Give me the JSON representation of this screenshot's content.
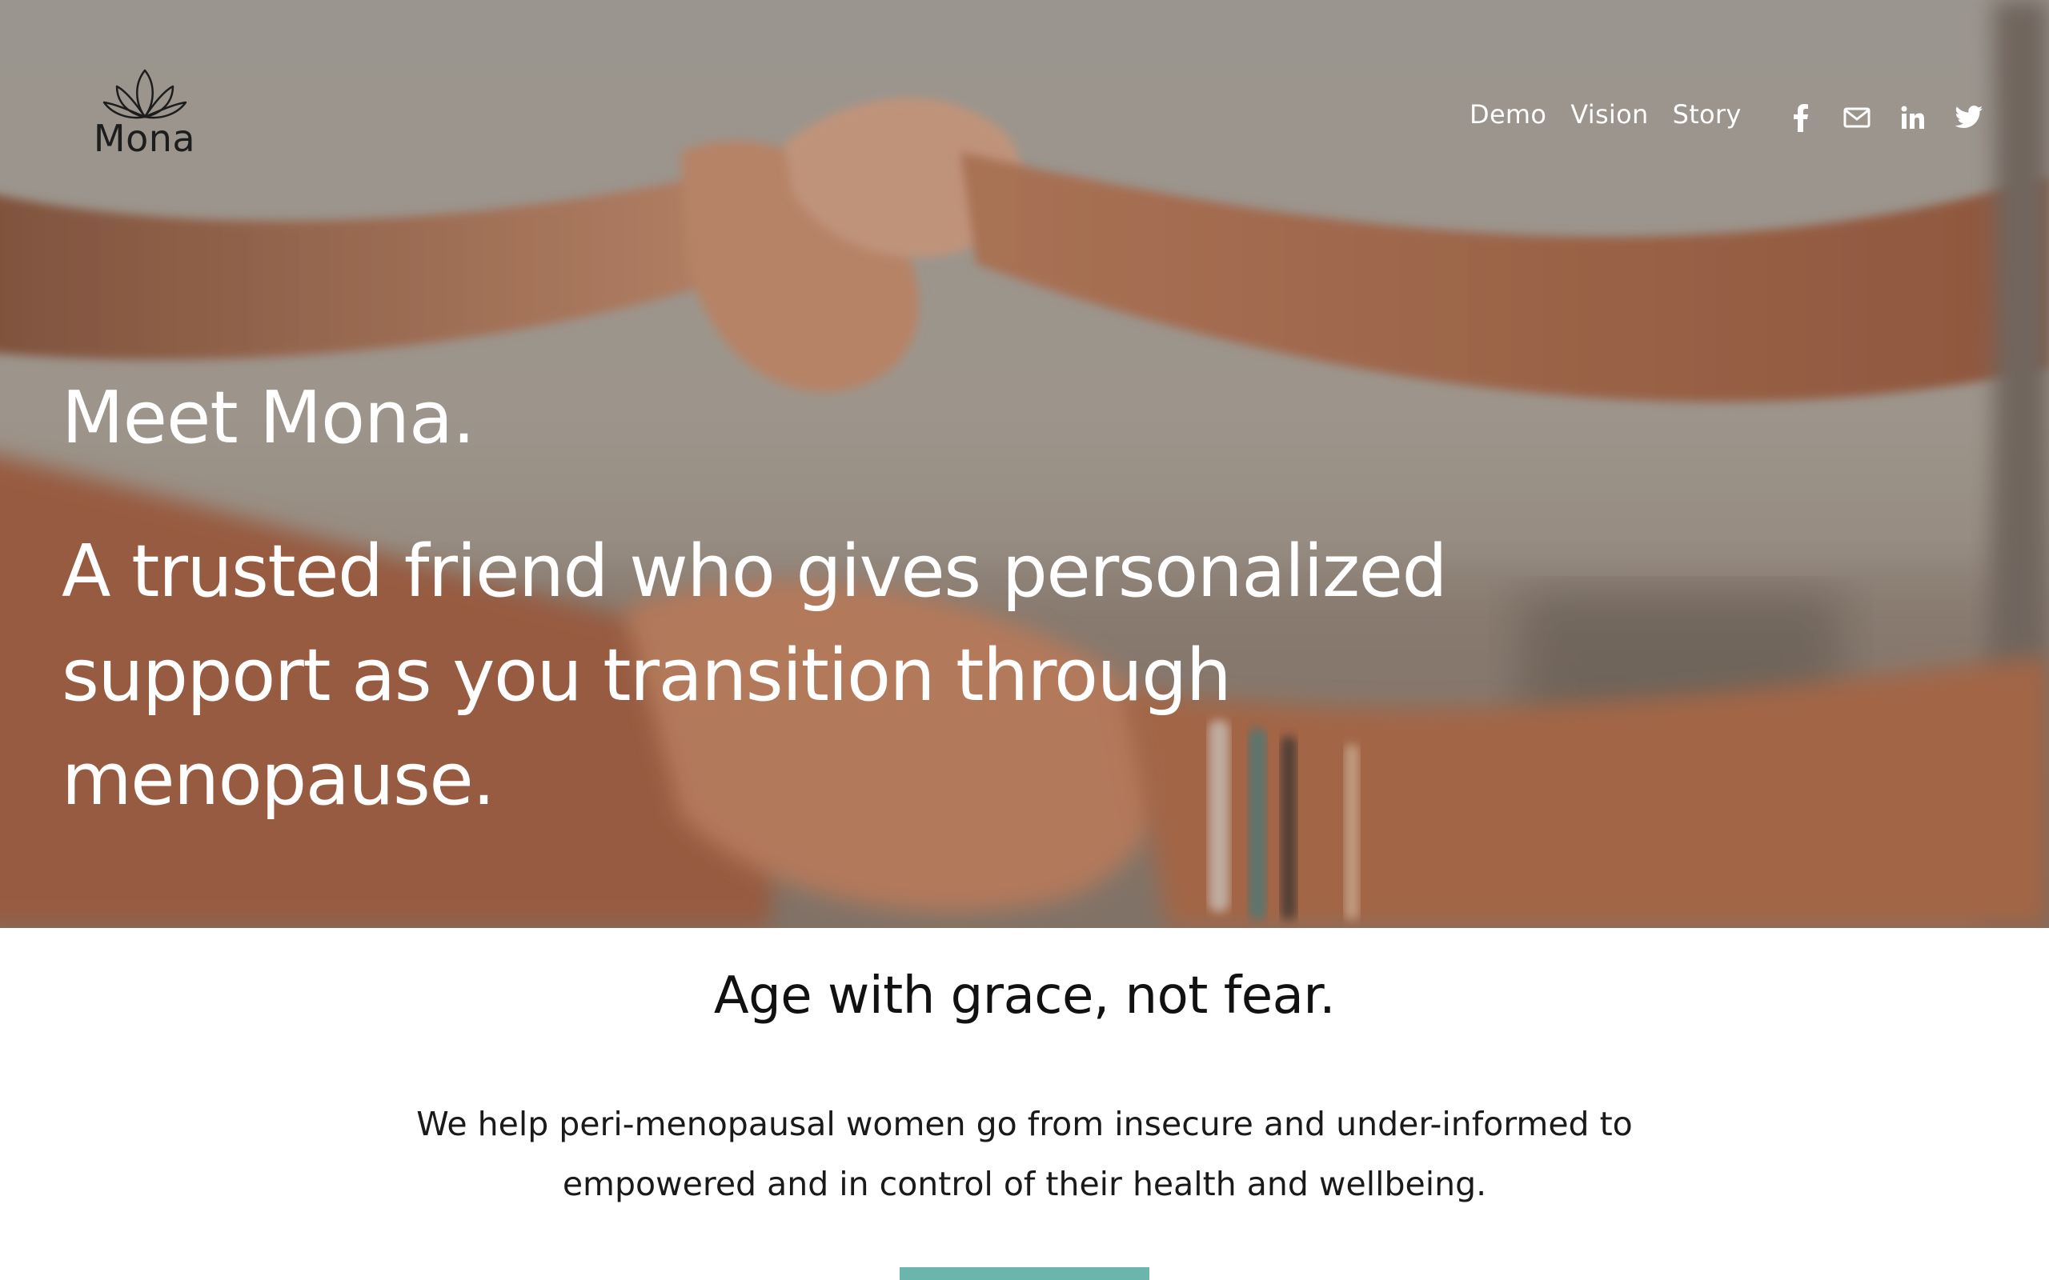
{
  "header": {
    "logo_text": "Mona",
    "nav": [
      {
        "label": "Demo"
      },
      {
        "label": "Vision"
      },
      {
        "label": "Story"
      }
    ],
    "social_icons": [
      "facebook-icon",
      "email-icon",
      "linkedin-icon",
      "twitter-icon"
    ]
  },
  "hero": {
    "title": "Meet Mona.",
    "subtitle": "A trusted friend who gives personalized support as you transition through menopause."
  },
  "content": {
    "tagline": "Age with grace, not fear.",
    "mission": "We help peri-menopausal women go from insecure and under-informed to empowered and in control of their health and wellbeing."
  },
  "colors": {
    "accent": "#6cb5ac",
    "hero_text": "#ffffff",
    "body_text": "#111111"
  }
}
